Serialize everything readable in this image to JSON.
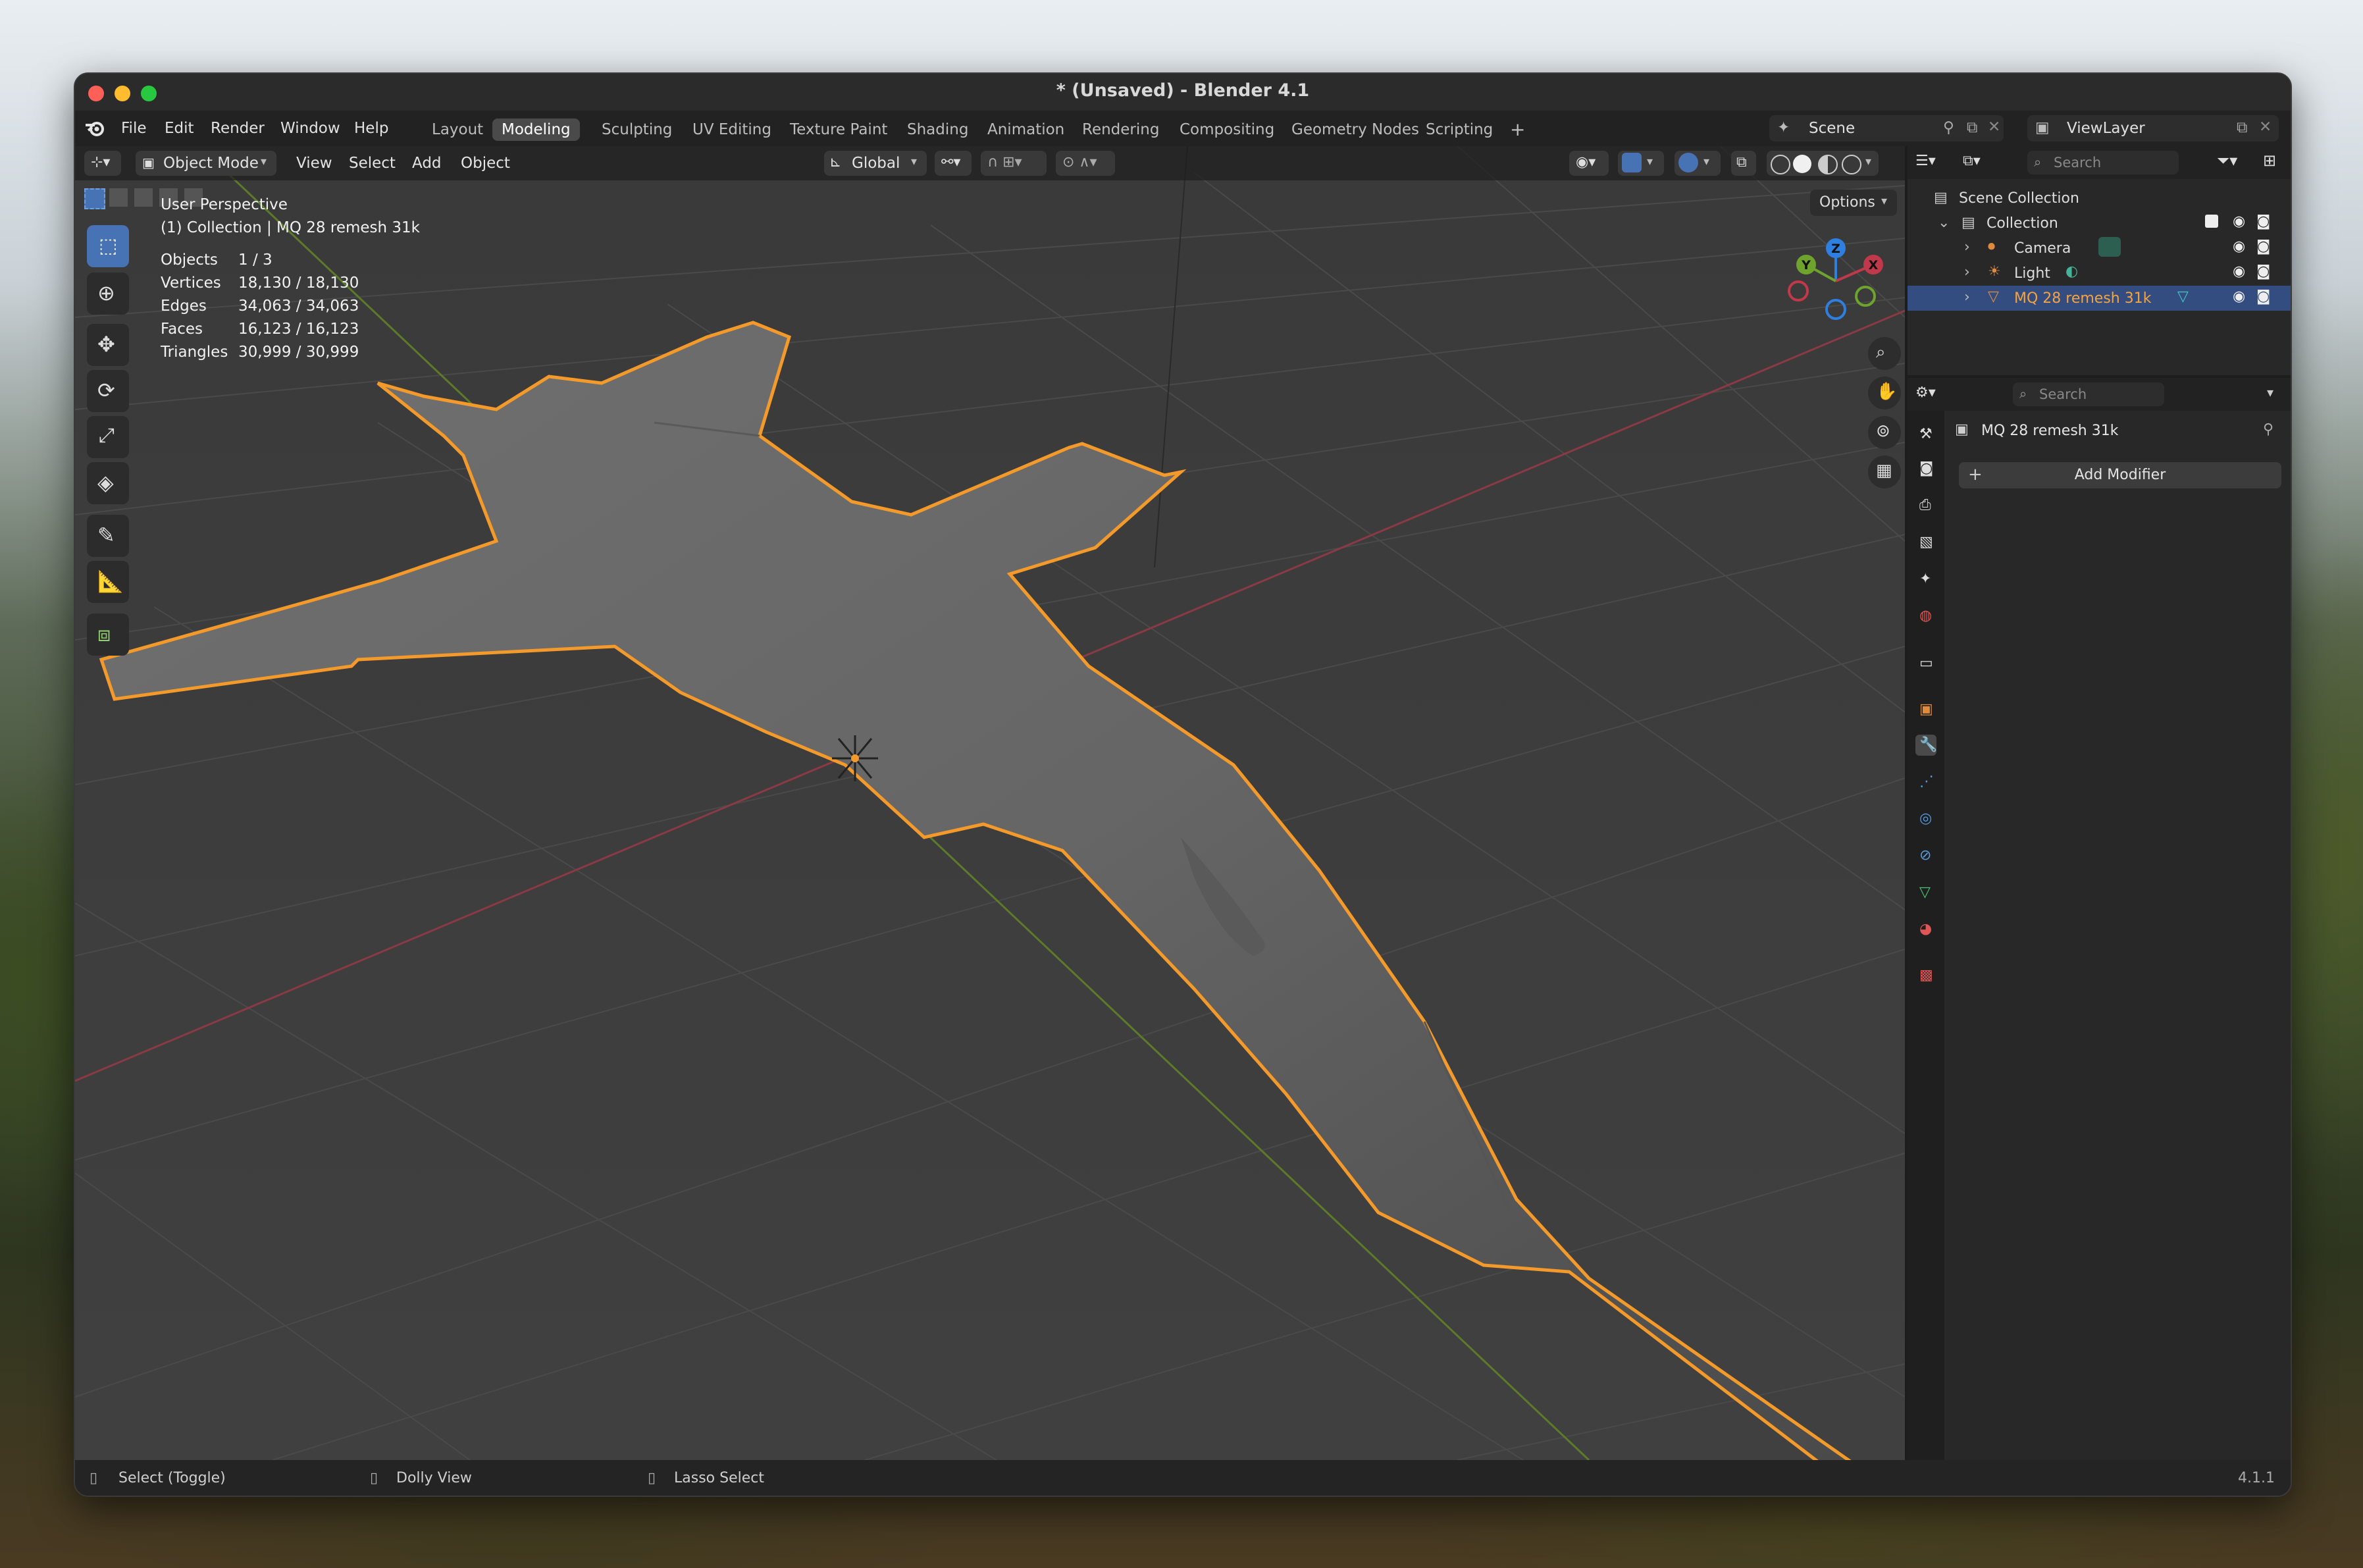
{
  "window": {
    "title": "* (Unsaved) - Blender 4.1"
  },
  "menu": [
    "File",
    "Edit",
    "Render",
    "Window",
    "Help"
  ],
  "workspaces": [
    "Layout",
    "Modeling",
    "Sculpting",
    "UV Editing",
    "Texture Paint",
    "Shading",
    "Animation",
    "Rendering",
    "Compositing",
    "Geometry Nodes",
    "Scripting"
  ],
  "active_workspace": "Modeling",
  "scene": {
    "name": "Scene"
  },
  "view_layer": {
    "name": "ViewLayer"
  },
  "viewport_header": {
    "mode": "Object Mode",
    "menus": [
      "View",
      "Select",
      "Add",
      "Object"
    ],
    "transform_orientation": "Global",
    "options": "Options"
  },
  "overlay_text": {
    "perspective": "User Perspective",
    "collection_line": "(1) Collection | MQ 28 remesh 31k",
    "stats": [
      {
        "label": "Objects",
        "value": "1 / 3"
      },
      {
        "label": "Vertices",
        "value": "18,130 / 18,130"
      },
      {
        "label": "Edges",
        "value": "34,063 / 34,063"
      },
      {
        "label": "Faces",
        "value": "16,123 / 16,123"
      },
      {
        "label": "Triangles",
        "value": "30,999 / 30,999"
      }
    ]
  },
  "gizmo_axes": {
    "x": "X",
    "y": "Y",
    "z": "Z"
  },
  "outliner": {
    "search_placeholder": "Search",
    "root": "Scene Collection",
    "collection": "Collection",
    "items": [
      "Camera",
      "Light",
      "MQ 28 remesh 31k"
    ],
    "selected": "MQ 28 remesh 31k"
  },
  "properties": {
    "search_placeholder": "Search",
    "object_name": "MQ 28 remesh 31k",
    "add_modifier": "Add Modifier"
  },
  "statusbar": {
    "left": "Select (Toggle)",
    "middle": "Dolly View",
    "right": "Lasso Select",
    "version": "4.1.1"
  },
  "colors": {
    "selection_outline": "#f39a2b",
    "accent": "#4772b3",
    "x_axis": "#c0394b",
    "y_axis": "#6ea32e",
    "z_axis": "#2f7fe0"
  }
}
